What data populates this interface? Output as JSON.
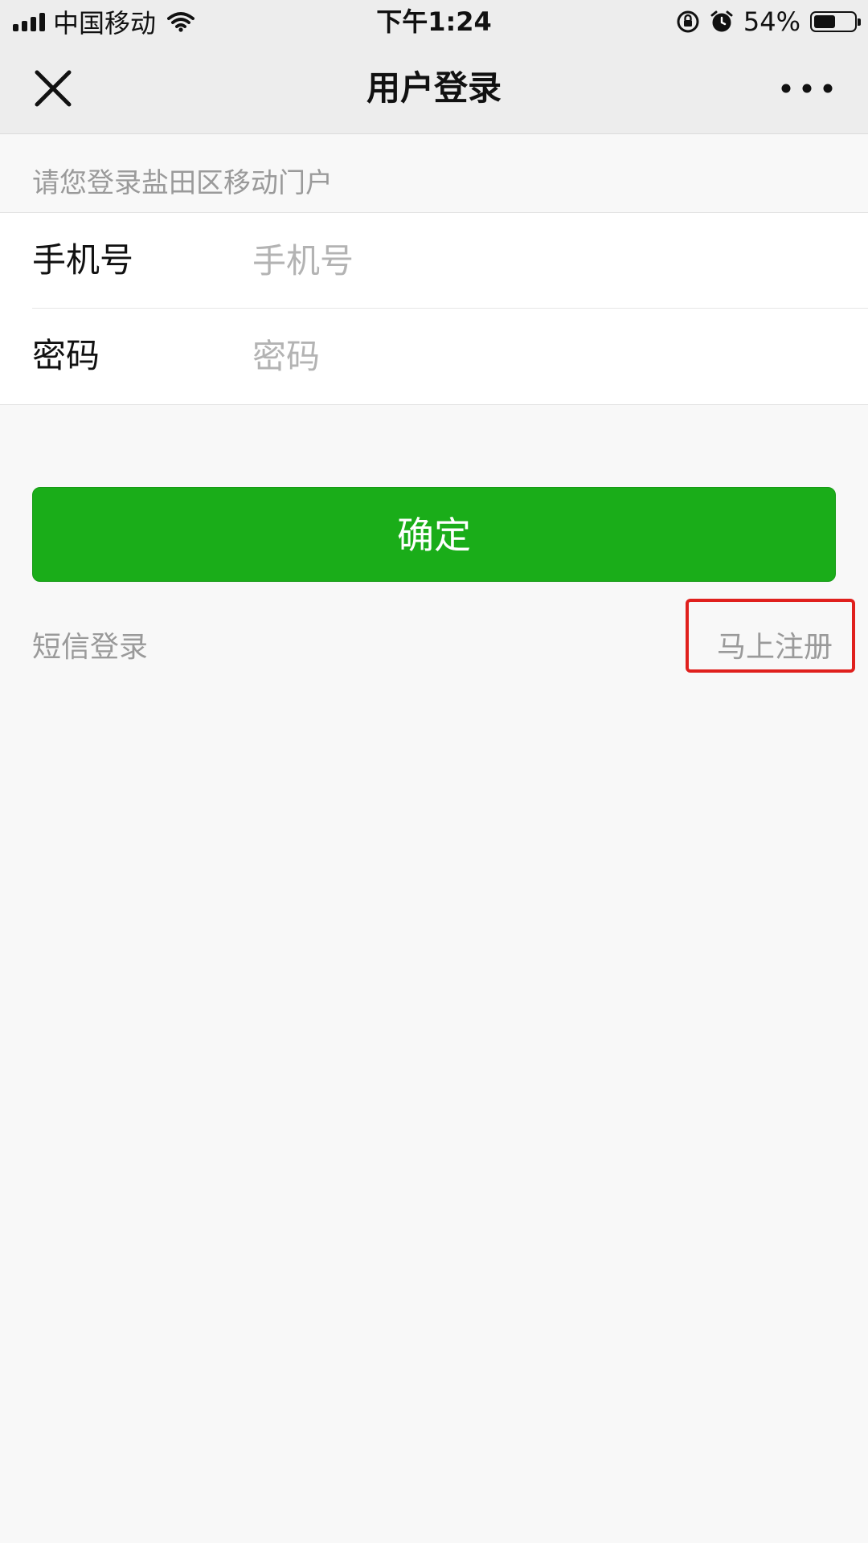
{
  "status_bar": {
    "carrier": "中国移动",
    "time": "下午1:24",
    "battery_percent": "54%",
    "battery_level": 0.54,
    "icons": [
      "signal-icon",
      "wifi-icon",
      "rotation-lock-icon",
      "alarm-icon",
      "battery-icon"
    ]
  },
  "nav": {
    "title": "用户登录",
    "close_icon": "close-icon",
    "more_icon": "more-icon"
  },
  "hint": "请您登录盐田区移动门户",
  "form": {
    "phone_label": "手机号",
    "phone_placeholder": "手机号",
    "phone_value": "",
    "password_label": "密码",
    "password_placeholder": "密码",
    "password_value": ""
  },
  "actions": {
    "confirm_label": "确定",
    "sms_login_label": "短信登录",
    "register_label": "马上注册"
  },
  "colors": {
    "accent_green": "#1aad19",
    "highlight_red": "#e0201d"
  }
}
